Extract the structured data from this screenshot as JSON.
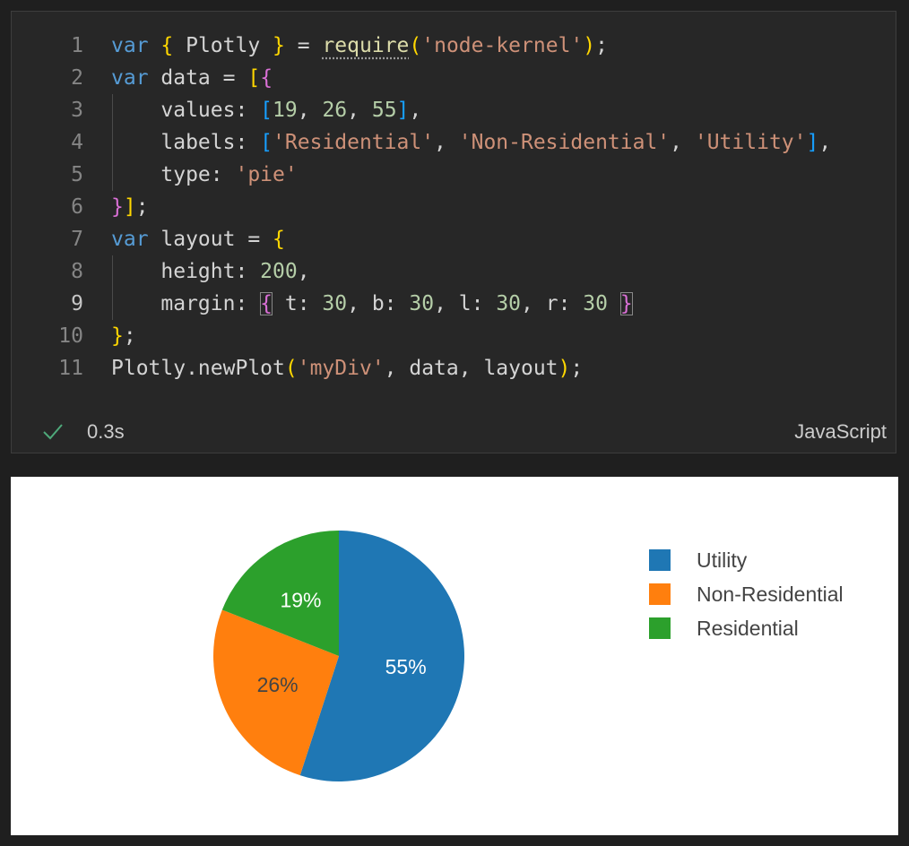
{
  "code": {
    "line_numbers": [
      "1",
      "2",
      "3",
      "4",
      "5",
      "6",
      "7",
      "8",
      "9",
      "10",
      "11"
    ],
    "active_line": "9",
    "lines": [
      {
        "tokens": [
          {
            "t": "var",
            "c": "kw"
          },
          {
            "t": " ",
            "c": "id"
          },
          {
            "t": "{",
            "c": "b1"
          },
          {
            "t": " Plotly ",
            "c": "id"
          },
          {
            "t": "}",
            "c": "b1"
          },
          {
            "t": " = ",
            "c": "id"
          },
          {
            "t": "require",
            "c": "fn squiggle"
          },
          {
            "t": "(",
            "c": "b1"
          },
          {
            "t": "'node-kernel'",
            "c": "str"
          },
          {
            "t": ")",
            "c": "b1"
          },
          {
            "t": ";",
            "c": "id"
          }
        ]
      },
      {
        "tokens": [
          {
            "t": "var",
            "c": "kw"
          },
          {
            "t": " data = ",
            "c": "id"
          },
          {
            "t": "[",
            "c": "b1"
          },
          {
            "t": "{",
            "c": "b2"
          }
        ]
      },
      {
        "tokens": [
          {
            "t": "    values: ",
            "c": "prop"
          },
          {
            "t": "[",
            "c": "b3"
          },
          {
            "t": "19",
            "c": "num"
          },
          {
            "t": ", ",
            "c": "id"
          },
          {
            "t": "26",
            "c": "num"
          },
          {
            "t": ", ",
            "c": "id"
          },
          {
            "t": "55",
            "c": "num"
          },
          {
            "t": "]",
            "c": "b3"
          },
          {
            "t": ",",
            "c": "id"
          }
        ]
      },
      {
        "tokens": [
          {
            "t": "    labels: ",
            "c": "prop"
          },
          {
            "t": "[",
            "c": "b3"
          },
          {
            "t": "'Residential'",
            "c": "str"
          },
          {
            "t": ", ",
            "c": "id"
          },
          {
            "t": "'Non-Residential'",
            "c": "str"
          },
          {
            "t": ", ",
            "c": "id"
          },
          {
            "t": "'Utility'",
            "c": "str"
          },
          {
            "t": "]",
            "c": "b3"
          },
          {
            "t": ",",
            "c": "id"
          }
        ]
      },
      {
        "tokens": [
          {
            "t": "    type: ",
            "c": "prop"
          },
          {
            "t": "'pie'",
            "c": "str"
          }
        ]
      },
      {
        "tokens": [
          {
            "t": "}",
            "c": "b2"
          },
          {
            "t": "]",
            "c": "b1"
          },
          {
            "t": ";",
            "c": "id"
          }
        ]
      },
      {
        "tokens": [
          {
            "t": "var",
            "c": "kw"
          },
          {
            "t": " layout = ",
            "c": "id"
          },
          {
            "t": "{",
            "c": "b1"
          }
        ]
      },
      {
        "tokens": [
          {
            "t": "    height: ",
            "c": "prop"
          },
          {
            "t": "200",
            "c": "num"
          },
          {
            "t": ",",
            "c": "id"
          }
        ]
      },
      {
        "tokens": [
          {
            "t": "    margin: ",
            "c": "prop"
          },
          {
            "t": "{",
            "c": "b2 bracket-box"
          },
          {
            "t": " t: ",
            "c": "id"
          },
          {
            "t": "30",
            "c": "num"
          },
          {
            "t": ", b: ",
            "c": "id"
          },
          {
            "t": "30",
            "c": "num"
          },
          {
            "t": ", l: ",
            "c": "id"
          },
          {
            "t": "30",
            "c": "num"
          },
          {
            "t": ", r: ",
            "c": "id"
          },
          {
            "t": "30",
            "c": "num"
          },
          {
            "t": " ",
            "c": "id"
          },
          {
            "t": "}",
            "c": "b2 bracket-box"
          }
        ]
      },
      {
        "tokens": [
          {
            "t": "}",
            "c": "b1"
          },
          {
            "t": ";",
            "c": "id"
          }
        ]
      },
      {
        "tokens": [
          {
            "t": "Plotly.newPlot",
            "c": "id"
          },
          {
            "t": "(",
            "c": "b1"
          },
          {
            "t": "'myDiv'",
            "c": "str"
          },
          {
            "t": ", data, layout",
            "c": "id"
          },
          {
            "t": ")",
            "c": "b1"
          },
          {
            "t": ";",
            "c": "id"
          }
        ]
      }
    ]
  },
  "status": {
    "check_icon": "check-icon",
    "time": "0.3s",
    "language": "JavaScript"
  },
  "colors": {
    "utility": "#1f77b4",
    "non_residential": "#ff7f0e",
    "residential": "#2ca02c"
  },
  "chart_data": {
    "type": "pie",
    "labels": [
      "Residential",
      "Non-Residential",
      "Utility"
    ],
    "values": [
      19,
      26,
      55
    ],
    "slice_labels": [
      "19%",
      "26%",
      "55%"
    ],
    "colors": [
      "#2ca02c",
      "#ff7f0e",
      "#1f77b4"
    ],
    "legend": [
      "Utility",
      "Non-Residential",
      "Residential"
    ],
    "legend_colors": [
      "#1f77b4",
      "#ff7f0e",
      "#2ca02c"
    ],
    "legend_position": "right",
    "sort": "descending",
    "direction": "clockwise"
  }
}
